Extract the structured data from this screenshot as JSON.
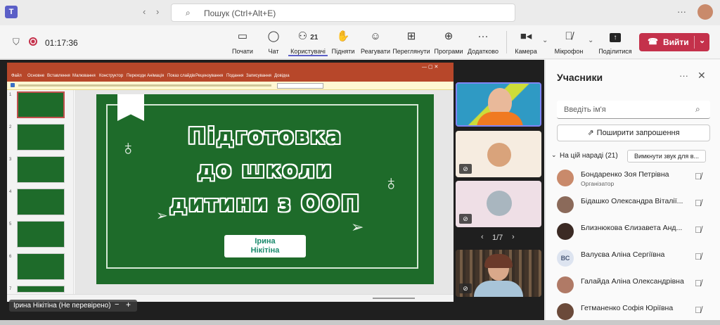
{
  "search": {
    "placeholder": "Пошук (Ctrl+Alt+E)"
  },
  "meeting": {
    "timer": "01:17:36",
    "participants_count": "21",
    "toolbar": [
      {
        "label": "Почати",
        "icon": "screen-share-icon"
      },
      {
        "label": "Чат",
        "icon": "chat-icon"
      },
      {
        "label": "Користувачі",
        "icon": "people-icon"
      },
      {
        "label": "Підняти",
        "icon": "raise-hand-icon"
      },
      {
        "label": "Реагувати",
        "icon": "react-icon"
      },
      {
        "label": "Переглянути",
        "icon": "view-icon"
      },
      {
        "label": "Програми",
        "icon": "apps-icon"
      },
      {
        "label": "Додатково",
        "icon": "more-icon"
      },
      {
        "label": "Камера",
        "icon": "camera-icon"
      },
      {
        "label": "Мікрофон",
        "icon": "mic-off-icon"
      },
      {
        "label": "Поділитися",
        "icon": "share-icon"
      }
    ],
    "leave_label": "Вийти"
  },
  "presentation": {
    "ribbon_tabs": [
      "Файл",
      "Основне",
      "Вставлення",
      "Малювання",
      "Конструктор",
      "Переходи",
      "Анімація",
      "Показ слайдів",
      "Рецензування",
      "Подання",
      "Записування",
      "Довідка"
    ],
    "slide_numbers": [
      "1",
      "2",
      "3",
      "4",
      "5",
      "6",
      "7"
    ],
    "slide_title_lines": [
      "Підготовка",
      "до школи",
      "дитини з ООП"
    ],
    "author_lines": [
      "Ірина",
      "Нікітіна"
    ],
    "presenter_tag": "Ірина Нікітіна (Не перевірено)"
  },
  "gallery": {
    "page": "1/7"
  },
  "panel": {
    "title": "Учасники",
    "name_placeholder": "Введіть ім'я",
    "share_invite": "Поширити запрошення",
    "section_label": "На цій нараді (21)",
    "mute_all": "Вимкнути звук для в...",
    "people": [
      {
        "name": "Бондаренко Зоя Петрівна",
        "role": "Організатор",
        "initials": ""
      },
      {
        "name": "Бідашко Олександра Віталії...",
        "role": "",
        "initials": ""
      },
      {
        "name": "Близнюкова Єлизавета Анд...",
        "role": "",
        "initials": ""
      },
      {
        "name": "Валуєва Аліна Сергіївна",
        "role": "",
        "initials": "ВС"
      },
      {
        "name": "Галайда Аліна Олександрівна",
        "role": "",
        "initials": ""
      },
      {
        "name": "Гетманенко Софія Юріївна",
        "role": "",
        "initials": ""
      }
    ]
  },
  "colors": {
    "accent": "#5b5fc7",
    "leave": "#c4314b",
    "slide_green": "#1e6b2a",
    "ppt_red": "#b7472a"
  }
}
